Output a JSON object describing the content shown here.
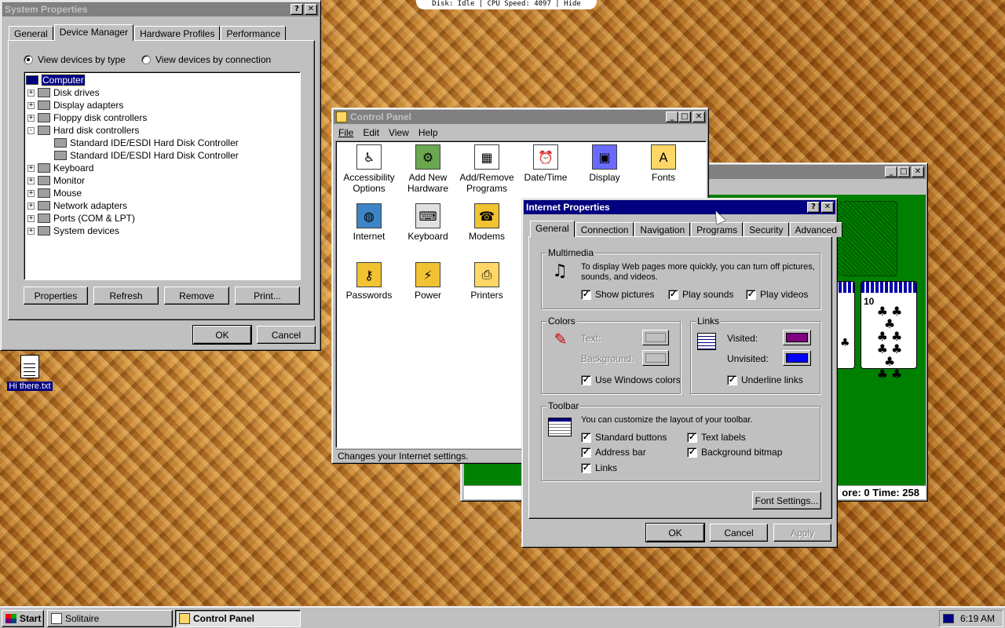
{
  "top_status": "Disk: Idle | CPU Speed: 4097 | Hide",
  "system_properties": {
    "title": "System Properties",
    "tabs": [
      "General",
      "Device Manager",
      "Hardware Profiles",
      "Performance"
    ],
    "radio_by_type": "View devices by type",
    "radio_by_connection": "View devices by connection",
    "tree": [
      {
        "label": "Computer",
        "level": 0,
        "expander": ""
      },
      {
        "label": "Disk drives",
        "level": 1,
        "expander": "+"
      },
      {
        "label": "Display adapters",
        "level": 1,
        "expander": "+"
      },
      {
        "label": "Floppy disk controllers",
        "level": 1,
        "expander": "+"
      },
      {
        "label": "Hard disk controllers",
        "level": 1,
        "expander": "-"
      },
      {
        "label": "Standard IDE/ESDI Hard Disk Controller",
        "level": 2,
        "expander": ""
      },
      {
        "label": "Standard IDE/ESDI Hard Disk Controller",
        "level": 2,
        "expander": ""
      },
      {
        "label": "Keyboard",
        "level": 1,
        "expander": "+"
      },
      {
        "label": "Monitor",
        "level": 1,
        "expander": "+"
      },
      {
        "label": "Mouse",
        "level": 1,
        "expander": "+"
      },
      {
        "label": "Network adapters",
        "level": 1,
        "expander": "+"
      },
      {
        "label": "Ports (COM & LPT)",
        "level": 1,
        "expander": "+"
      },
      {
        "label": "System devices",
        "level": 1,
        "expander": "+"
      }
    ],
    "btn_properties": "Properties",
    "btn_refresh": "Refresh",
    "btn_remove": "Remove",
    "btn_print": "Print...",
    "btn_ok": "OK",
    "btn_cancel": "Cancel"
  },
  "desktop_icon": {
    "label": "Hi there.txt"
  },
  "control_panel": {
    "title": "Control Panel",
    "menu": [
      "File",
      "Edit",
      "View",
      "Help"
    ],
    "items": [
      {
        "label": "Accessibility Options",
        "icon": "accessibility-icon",
        "glyph": "♿",
        "color": "#ffffff"
      },
      {
        "label": "Add New Hardware",
        "icon": "add-hardware-icon",
        "glyph": "⚙",
        "color": "#6aa84f"
      },
      {
        "label": "Add/Remove Programs",
        "icon": "add-remove-programs-icon",
        "glyph": "▦",
        "color": "#ffffff"
      },
      {
        "label": "Date/Time",
        "icon": "date-time-icon",
        "glyph": "⏰",
        "color": "#ffffff"
      },
      {
        "label": "Display",
        "icon": "display-icon",
        "glyph": "▣",
        "color": "#6a6aff"
      },
      {
        "label": "Fonts",
        "icon": "fonts-icon",
        "glyph": "A",
        "color": "#ffd766"
      },
      {
        "label": "Internet",
        "icon": "internet-icon",
        "glyph": "◍",
        "color": "#3d85c6"
      },
      {
        "label": "Keyboard",
        "icon": "keyboard-icon",
        "glyph": "⌨",
        "color": "#e0e0e0"
      },
      {
        "label": "Modems",
        "icon": "modems-icon",
        "glyph": "☎",
        "color": "#f1c232"
      },
      {
        "label": "Passwords",
        "icon": "passwords-icon",
        "glyph": "⚷",
        "color": "#f1c232"
      },
      {
        "label": "Power",
        "icon": "power-icon",
        "glyph": "⚡",
        "color": "#f1c232"
      },
      {
        "label": "Printers",
        "icon": "printers-icon",
        "glyph": "⎙",
        "color": "#ffd766"
      }
    ],
    "status": "Changes your Internet settings."
  },
  "solitaire": {
    "status": "ore: 0 Time: 258",
    "card_ten_label": "10"
  },
  "internet_properties": {
    "title": "Internet Properties",
    "tabs": [
      "General",
      "Connection",
      "Navigation",
      "Programs",
      "Security",
      "Advanced"
    ],
    "multimedia": {
      "label": "Multimedia",
      "description": "To display Web pages more quickly, you can turn off pictures, sounds, and videos.",
      "show_pictures": "Show pictures",
      "play_sounds": "Play sounds",
      "play_videos": "Play videos"
    },
    "colors": {
      "label": "Colors",
      "text": "Text:",
      "background": "Background:",
      "use_windows": "Use Windows colors"
    },
    "links": {
      "label": "Links",
      "visited": "Visited:",
      "unvisited": "Unvisited:",
      "underline": "Underline links",
      "visited_color": "#800080",
      "unvisited_color": "#0000ff"
    },
    "toolbar": {
      "label": "Toolbar",
      "description": "You can customize the layout of your toolbar.",
      "standard_buttons": "Standard buttons",
      "text_labels": "Text labels",
      "address_bar": "Address bar",
      "background_bitmap": "Background bitmap",
      "links": "Links"
    },
    "btn_font_settings": "Font Settings...",
    "btn_ok": "OK",
    "btn_cancel": "Cancel",
    "btn_apply": "Apply"
  },
  "taskbar": {
    "start": "Start",
    "tasks": [
      "Solitaire",
      "Control Panel"
    ],
    "clock": "6:19 AM"
  }
}
